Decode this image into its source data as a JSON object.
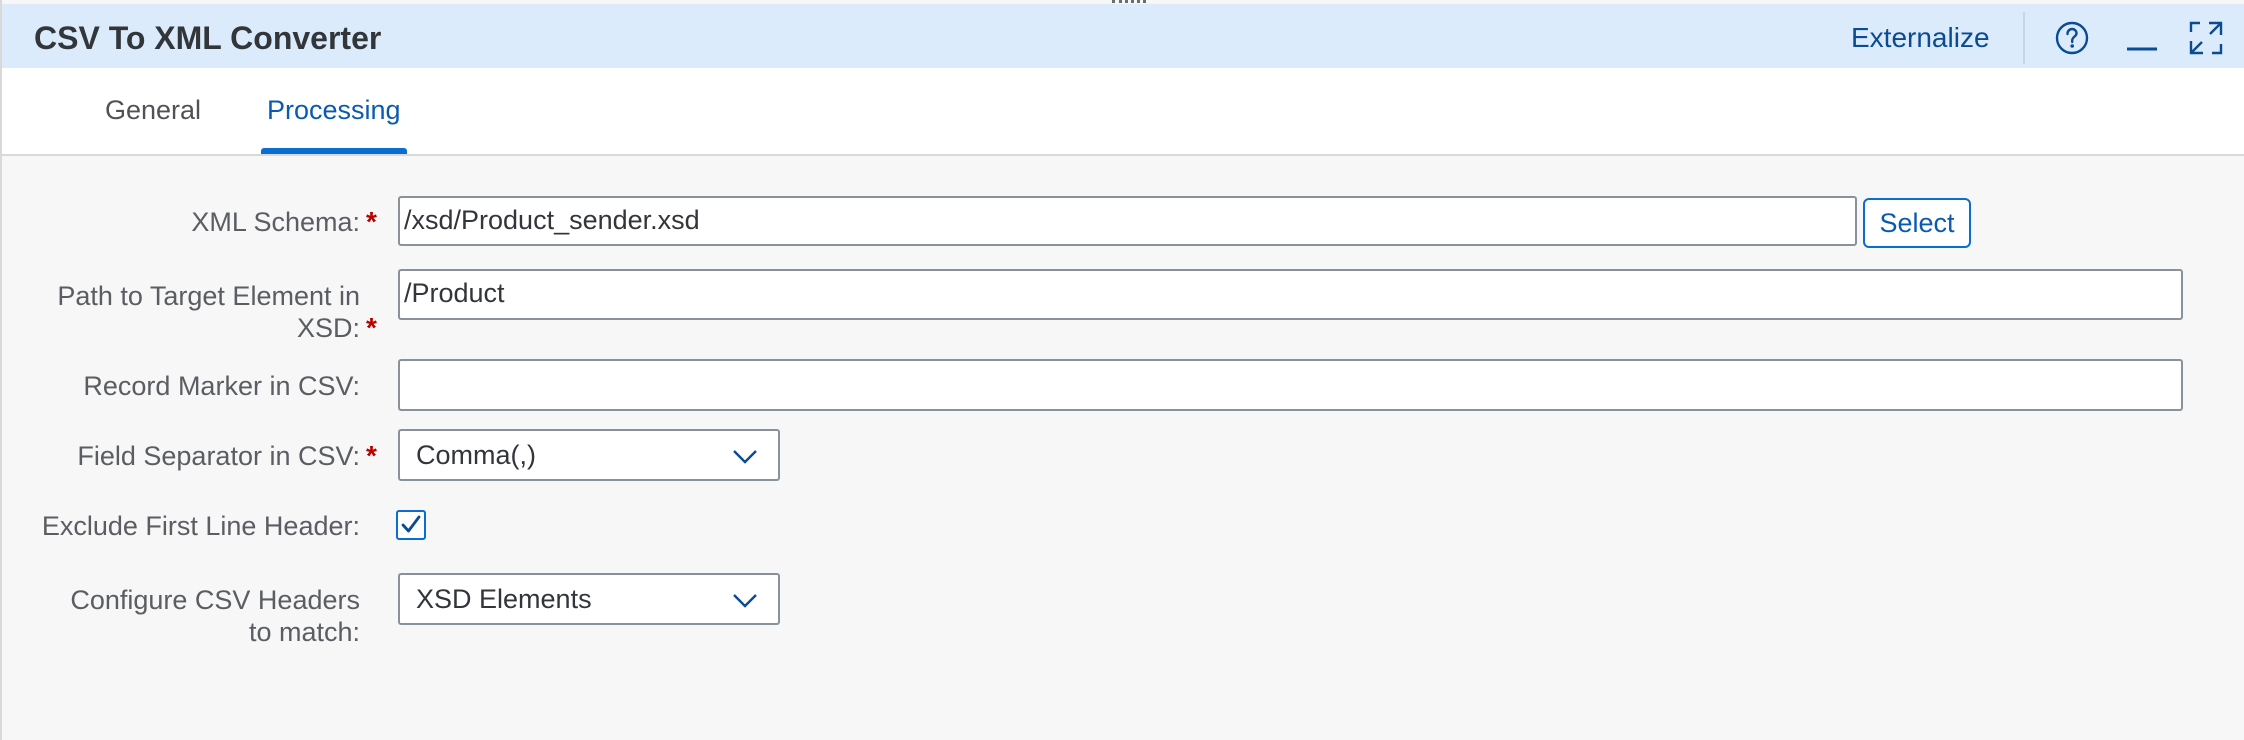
{
  "header": {
    "title": "CSV To XML Converter",
    "externalize_label": "Externalize",
    "icons": [
      "help-icon",
      "minimize-icon",
      "maximize-icon"
    ]
  },
  "tabs": [
    {
      "label": "General",
      "selected": false
    },
    {
      "label": "Processing",
      "selected": true
    }
  ],
  "form": {
    "xml_schema": {
      "label": "XML Schema:",
      "value": "/xsd/Product_sender.xsd",
      "required": true,
      "select_label": "Select"
    },
    "path_to_target": {
      "label_line1": "Path to Target Element in",
      "label_line2": "XSD:",
      "value": "/Product",
      "required": true
    },
    "record_marker": {
      "label": "Record Marker in CSV:",
      "value": "",
      "required": false
    },
    "field_separator": {
      "label": "Field Separator in CSV:",
      "value": "Comma(,)",
      "required": true
    },
    "exclude_header": {
      "label": "Exclude First Line Header:",
      "checked": true
    },
    "configure_headers": {
      "label_line1": "Configure CSV Headers",
      "label_line2": "to match:",
      "value": "XSD Elements"
    },
    "required_marker": "*"
  },
  "colors": {
    "header_bg": "#dcebfb",
    "accent": "#0a6ed1",
    "required": "#bb0000",
    "body_bg": "#f7f7f7"
  }
}
